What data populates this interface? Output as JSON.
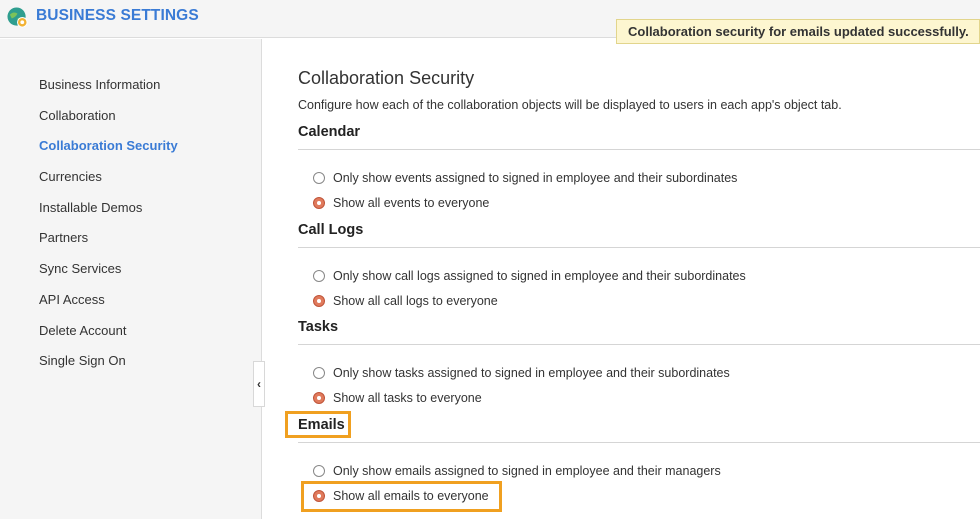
{
  "header": {
    "title": "BUSINESS SETTINGS",
    "logo_icon": "globe-gear-icon"
  },
  "toast": {
    "message": "Collaboration security for emails updated successfully."
  },
  "sidebar": {
    "items": [
      {
        "label": "Business Information",
        "active": false
      },
      {
        "label": "Collaboration",
        "active": false
      },
      {
        "label": "Collaboration Security",
        "active": true
      },
      {
        "label": "Currencies",
        "active": false
      },
      {
        "label": "Installable Demos",
        "active": false
      },
      {
        "label": "Partners",
        "active": false
      },
      {
        "label": "Sync Services",
        "active": false
      },
      {
        "label": "API Access",
        "active": false
      },
      {
        "label": "Delete Account",
        "active": false
      },
      {
        "label": "Single Sign On",
        "active": false
      }
    ],
    "collapse_icon": "chevron-left-icon"
  },
  "main": {
    "title": "Collaboration Security",
    "description": "Configure how each of the collaboration objects will be displayed to users in each app's object tab.",
    "sections": [
      {
        "name": "Calendar",
        "options": [
          "Only show events assigned to signed in employee and their subordinates",
          "Show all events to everyone"
        ],
        "selected": 1
      },
      {
        "name": "Call Logs",
        "options": [
          "Only show call logs assigned to signed in employee and their subordinates",
          "Show all call logs to everyone"
        ],
        "selected": 1
      },
      {
        "name": "Tasks",
        "options": [
          "Only show tasks assigned to signed in employee and their subordinates",
          "Show all tasks to everyone"
        ],
        "selected": 1
      },
      {
        "name": "Emails",
        "options": [
          "Only show emails assigned to signed in employee and their managers",
          "Show all emails to everyone"
        ],
        "selected": 1
      }
    ]
  },
  "colors": {
    "accent": "#3a7bd5",
    "highlight": "#f0a020",
    "radio_selected": "#e07a5c",
    "toast_bg": "#fdf6d0"
  }
}
